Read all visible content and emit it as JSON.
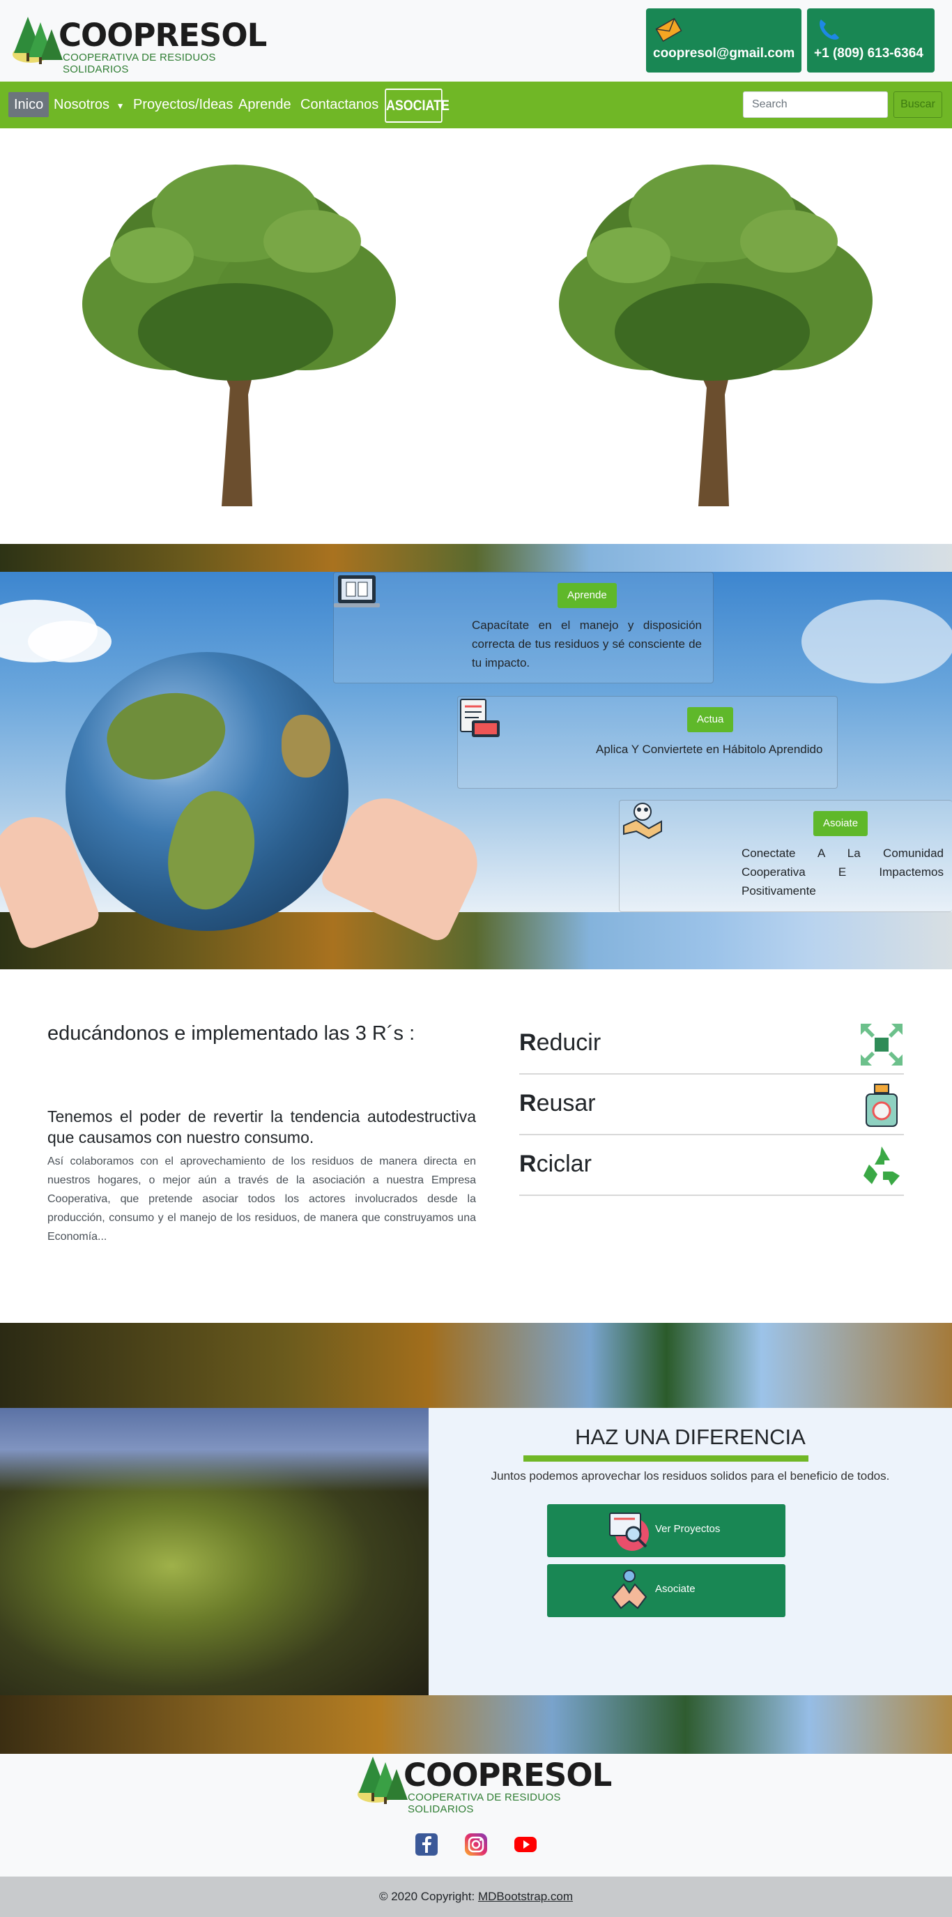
{
  "brand": {
    "name": "COOPRESOL",
    "tagline": "COOPERATIVA DE RESIDUOS SOLIDARIOS"
  },
  "contact": {
    "email": "coopresol@gmail.com",
    "phone": "+1 (809) 613-6364"
  },
  "nav": {
    "items": [
      "Inico",
      "Nosotros",
      "Proyectos/Ideas",
      "Aprende",
      "Contactanos"
    ],
    "asociate": "ASOCIATE",
    "search_placeholder": "Search",
    "search_button": "Buscar"
  },
  "cards": [
    {
      "badge": "Aprende",
      "text": "Capacítate en el manejo y disposición correcta de tus residuos y sé consciente de tu impacto.",
      "icon": "laptop-book-icon"
    },
    {
      "badge": "Actua",
      "text": "Aplica Y Conviertete en Hábitolo Aprendido",
      "icon": "document-computer-icon"
    },
    {
      "badge": "Asoiate",
      "text": "Conectate A La Comunidad Cooperativa E Impactemos Positivamente",
      "icon": "handshake-icon"
    }
  ],
  "rrr": {
    "heading": "educándonos e implementado las 3 R´s :",
    "subheading": "Tenemos el poder de revertir la tendencia autodestructiva que causamos con nuestro consumo.",
    "paragraph": "Así colaboramos con el aprovechamiento de los residuos de manera directa en nuestros hogares, o mejor aún a través de la asociación a nuestra Empresa Cooperativa, que pretende asociar todos los actores involucrados desde la producción, consumo y el manejo de los residuos, de manera que construyamos una Economía...",
    "items": [
      {
        "initial": "R",
        "rest": "educir",
        "icon": "reduce-arrows-icon"
      },
      {
        "initial": "R",
        "rest": "eusar",
        "icon": "reuse-bottle-icon"
      },
      {
        "initial": "R",
        "rest": "ciclar",
        "icon": "recycle-icon"
      }
    ]
  },
  "difference": {
    "title": "HAZ UNA DIFERENCIA",
    "lead": "Juntos podemos aprovechar los residuos solidos para el beneficio de todos.",
    "buttons": [
      "Ver Proyectos",
      "Asociate"
    ]
  },
  "footer": {
    "social": [
      "facebook-icon",
      "instagram-icon",
      "youtube-icon"
    ],
    "copyright_prefix": "© 2020 Copyright: ",
    "copyright_link": "MDBootstrap.com"
  },
  "colors": {
    "green": "#70b726",
    "dark_green": "#198754",
    "badge_green": "#5fb82a"
  }
}
